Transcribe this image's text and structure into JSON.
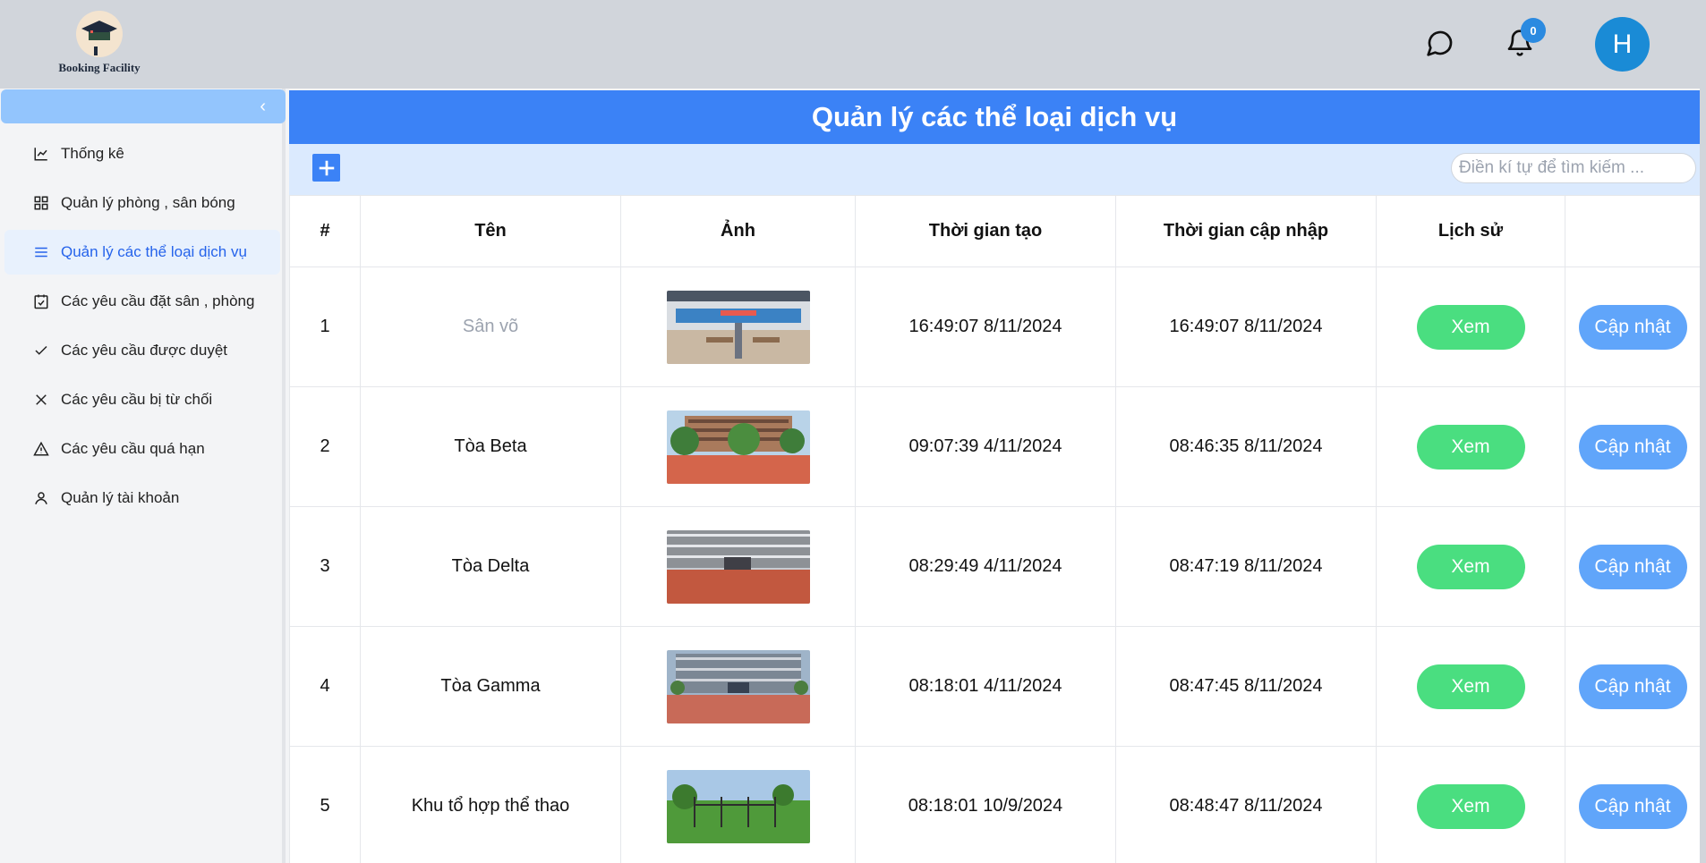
{
  "brand": {
    "name": "Booking Facility",
    "logo_icon": "graduation-cap-logo"
  },
  "header": {
    "icons": [
      "message-circle-icon",
      "bell-icon"
    ],
    "notification_count": "0",
    "avatar_letter": "H",
    "colors": {
      "topbar": "#d1d5db",
      "avatar": "#1a8bd6",
      "badge": "#2b8ae0"
    }
  },
  "sidebar": {
    "collapse_icon": "chevron-left-icon",
    "items": [
      {
        "label": "Thống kê",
        "icon": "line-chart-icon",
        "active": false
      },
      {
        "label": "Quản lý phòng , sân bóng",
        "icon": "grid-icon",
        "active": false
      },
      {
        "label": "Quản lý các thể loại dịch vụ",
        "icon": "menu-list-icon",
        "active": true
      },
      {
        "label": "Các yêu cầu đặt sân , phòng",
        "icon": "calendar-check-icon",
        "active": false
      },
      {
        "label": "Các yêu cầu được duyệt",
        "icon": "check-icon",
        "active": false
      },
      {
        "label": "Các yêu cầu bị từ chối",
        "icon": "x-icon",
        "active": false
      },
      {
        "label": "Các yêu cầu quá hạn",
        "icon": "warning-triangle-icon",
        "active": false
      },
      {
        "label": "Quản lý tài khoản",
        "icon": "user-icon",
        "active": false
      }
    ]
  },
  "page": {
    "title": "Quản lý các thể loại dịch vụ",
    "add_icon": "plus-icon",
    "search_placeholder": "Điền kí tự để tìm kiếm ...",
    "accent": "#3b82f6"
  },
  "table": {
    "headers": [
      "#",
      "Tên",
      "Ảnh",
      "Thời gian tạo",
      "Thời gian cập nhập",
      "Lịch sử",
      ""
    ],
    "view_label": "Xem",
    "update_label": "Cập nhật",
    "rows": [
      {
        "no": "1",
        "name": "Sân võ",
        "name_muted": true,
        "image": "covered-sports-hall-photo",
        "created": "16:49:07 8/11/2024",
        "updated": "16:49:07 8/11/2024"
      },
      {
        "no": "2",
        "name": "Tòa Beta",
        "name_muted": false,
        "image": "building-with-trees-photo",
        "created": "09:07:39 4/11/2024",
        "updated": "08:46:35 8/11/2024"
      },
      {
        "no": "3",
        "name": "Tòa Delta",
        "name_muted": false,
        "image": "building-with-brick-plaza-photo",
        "created": "08:29:49 4/11/2024",
        "updated": "08:47:19 8/11/2024"
      },
      {
        "no": "4",
        "name": "Tòa Gamma",
        "name_muted": false,
        "image": "building-facade-photo",
        "created": "08:18:01 4/11/2024",
        "updated": "08:47:45 8/11/2024"
      },
      {
        "no": "5",
        "name": "Khu tổ hợp thể thao",
        "name_muted": false,
        "image": "outdoor-sports-field-photo",
        "created": "08:18:01 10/9/2024",
        "updated": "08:48:47 8/11/2024"
      }
    ]
  }
}
